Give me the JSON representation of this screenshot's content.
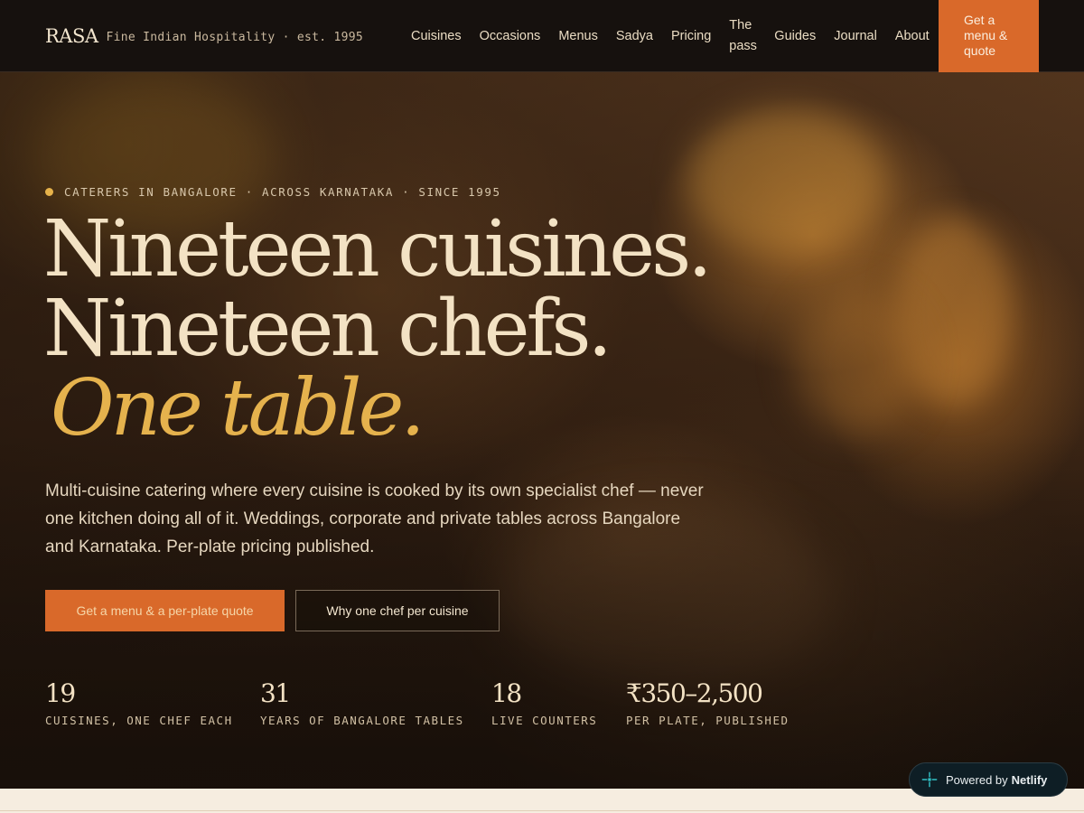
{
  "brand": {
    "name": "RASA",
    "tagline": "Fine Indian Hospitality · est. 1995"
  },
  "nav": {
    "items": [
      {
        "label": "Cuisines"
      },
      {
        "label": "Occasions"
      },
      {
        "label": "Menus"
      },
      {
        "label": "Sadya"
      },
      {
        "label": "Pricing"
      },
      {
        "label": "The pass"
      },
      {
        "label": "Guides"
      },
      {
        "label": "Journal"
      },
      {
        "label": "About"
      }
    ],
    "cta": "Get a menu & quote"
  },
  "hero": {
    "eyebrow": "CATERERS IN BANGALORE · ACROSS KARNATAKA · SINCE 1995",
    "headline_line1": "Nineteen cuisines.",
    "headline_line2": "Nineteen chefs.",
    "headline_accent": "One table.",
    "lede": "Multi-cuisine catering where every cuisine is cooked by its own specialist chef — never one kitchen doing all of it. Weddings, corporate and private tables across Bangalore and Karnataka. Per-plate pricing published.",
    "primary_button": "Get a menu & a per-plate quote",
    "secondary_button": "Why one chef per cuisine"
  },
  "stats": [
    {
      "value": "19",
      "label": "CUISINES, ONE CHEF EACH"
    },
    {
      "value": "31",
      "label": "YEARS OF BANGALORE TABLES"
    },
    {
      "value": "18",
      "label": "LIVE COUNTERS"
    },
    {
      "value": "₹350–2,500",
      "label": "PER PLATE, PUBLISHED"
    }
  ],
  "badge": {
    "prefix": "Powered by",
    "name": "Netlify"
  },
  "colors": {
    "accent": "#d9692a",
    "gold": "#e5b24d",
    "cream": "#f3e2c4",
    "nav_bg": "#16110e"
  }
}
